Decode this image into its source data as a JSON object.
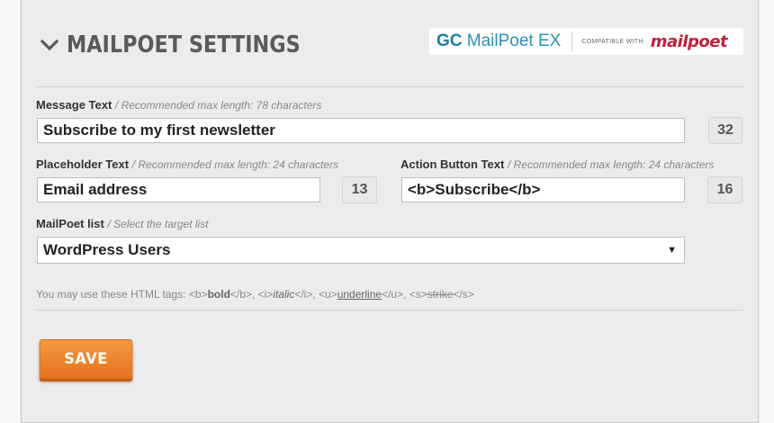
{
  "header": {
    "title": "MAILPOET SETTINGS",
    "logo_gc": "GC",
    "logo_product": "MailPoet EX",
    "logo_compat": "COMPATIBLE WITH",
    "logo_mailpoet": "mailpoet"
  },
  "message": {
    "label": "Message Text",
    "hint": "/ Recommended max length: 78 characters",
    "value": "Subscribe to my first newsletter",
    "count": "32"
  },
  "placeholder": {
    "label": "Placeholder Text",
    "hint": "/ Recommended max length: 24 characters",
    "value": "Email address",
    "count": "13"
  },
  "action_button": {
    "label": "Action Button Text",
    "hint": "/ Recommended max length: 24 characters",
    "value": "<b>Subscribe</b>",
    "count": "16"
  },
  "list": {
    "label": "MailPoet list",
    "hint": "/ Select the target list",
    "selected": "WordPress Users",
    "arrow": "▼"
  },
  "help": {
    "prefix": "You may use these HTML tags: ",
    "b_open": "<b>",
    "bold": "bold",
    "b_close": "</b>, ",
    "i_open": "<i>",
    "italic": "italic",
    "i_close": "</i>, ",
    "u_open": "<u>",
    "underline": "underline",
    "u_close": "</u>, ",
    "s_open": "<s>",
    "strike": "strike",
    "s_close": "</s>"
  },
  "save_label": "SAVE",
  "colors": {
    "accent_orange": "#f08a30",
    "logo_blue": "#2d8fb6",
    "logo_red": "#c2203a"
  }
}
